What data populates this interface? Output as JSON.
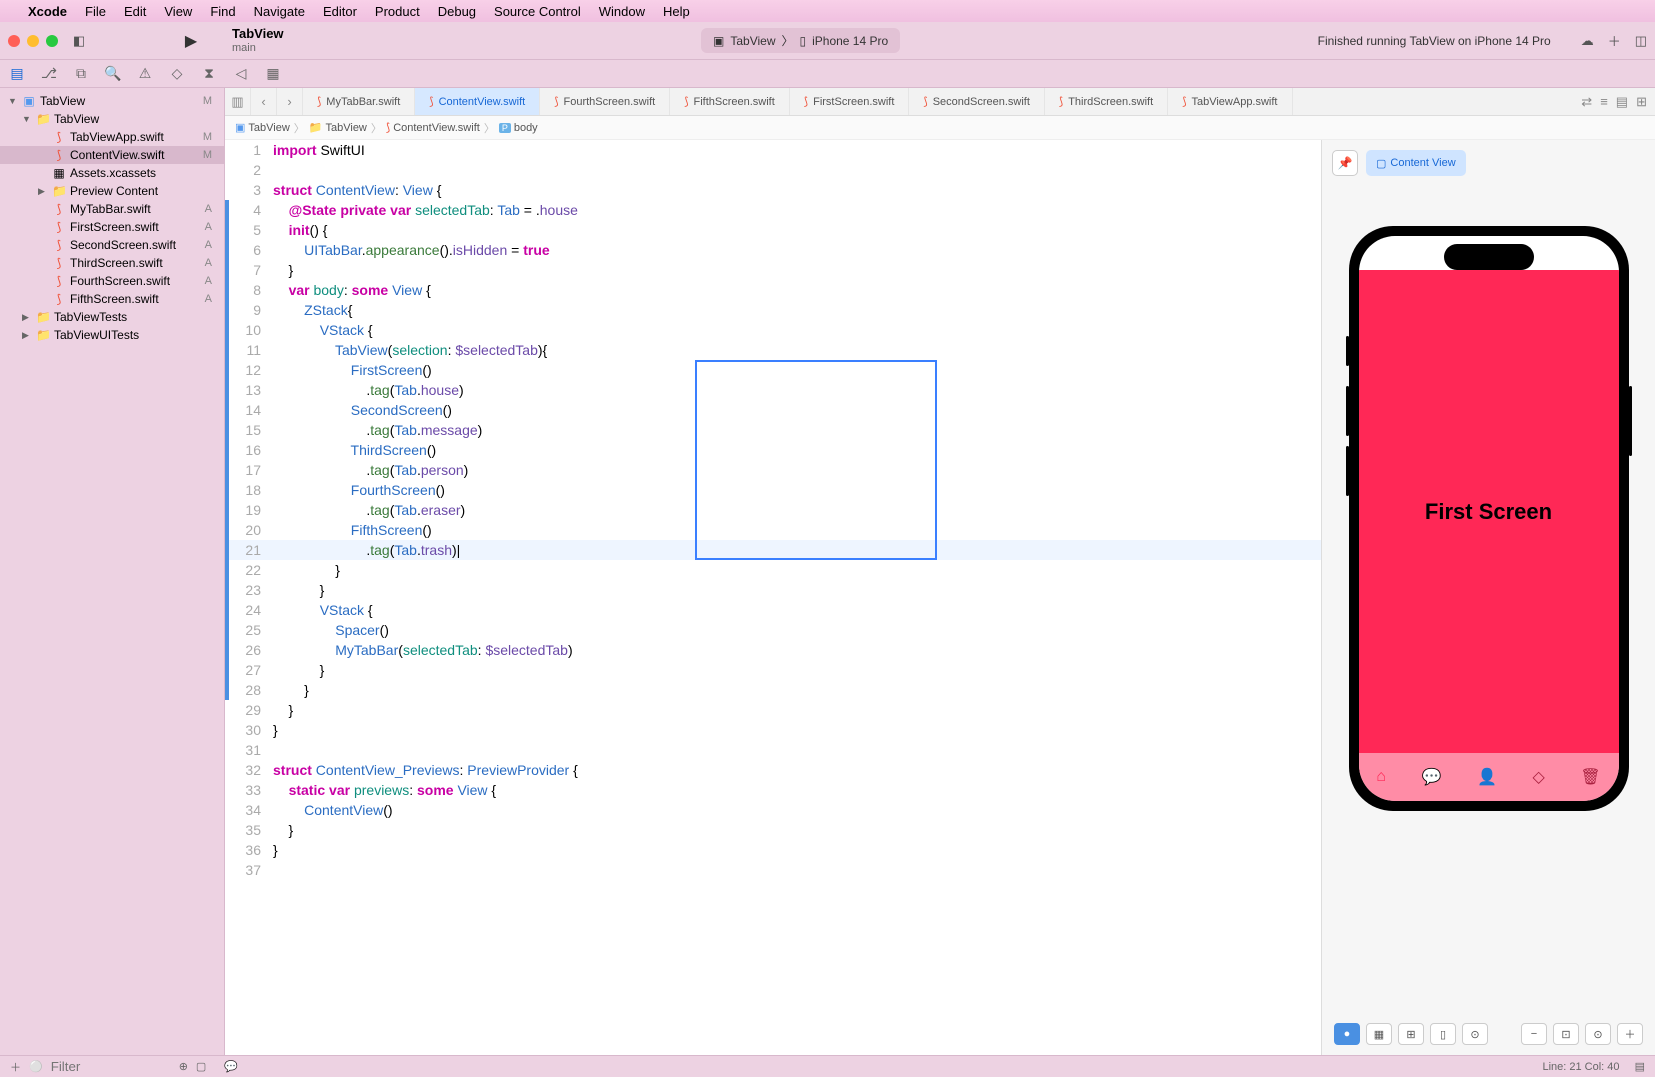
{
  "menubar": {
    "app": "Xcode",
    "items": [
      "File",
      "Edit",
      "View",
      "Find",
      "Navigate",
      "Editor",
      "Product",
      "Debug",
      "Source Control",
      "Window",
      "Help"
    ]
  },
  "toolbar": {
    "scheme_title": "TabView",
    "scheme_branch": "main",
    "run_target_scheme": "TabView",
    "run_target_device": "iPhone 14 Pro",
    "status": "Finished running TabView on iPhone 14 Pro"
  },
  "tabs": [
    {
      "name": "MyTabBar.swift",
      "active": false
    },
    {
      "name": "ContentView.swift",
      "active": true
    },
    {
      "name": "FourthScreen.swift",
      "active": false
    },
    {
      "name": "FifthScreen.swift",
      "active": false
    },
    {
      "name": "FirstScreen.swift",
      "active": false
    },
    {
      "name": "SecondScreen.swift",
      "active": false
    },
    {
      "name": "ThirdScreen.swift",
      "active": false
    },
    {
      "name": "TabViewApp.swift",
      "active": false
    }
  ],
  "jumpbar": [
    "TabView",
    "TabView",
    "ContentView.swift",
    "body"
  ],
  "sidebar": [
    {
      "indent": 0,
      "icon": "proj",
      "name": "TabView",
      "badge": "M",
      "disclosure": "▼"
    },
    {
      "indent": 1,
      "icon": "folder",
      "name": "TabView",
      "disclosure": "▼"
    },
    {
      "indent": 2,
      "icon": "swift",
      "name": "TabViewApp.swift",
      "badge": "M"
    },
    {
      "indent": 2,
      "icon": "swift",
      "name": "ContentView.swift",
      "badge": "M",
      "selected": true
    },
    {
      "indent": 2,
      "icon": "assets",
      "name": "Assets.xcassets"
    },
    {
      "indent": 2,
      "icon": "folder",
      "name": "Preview Content",
      "disclosure": "▶"
    },
    {
      "indent": 2,
      "icon": "swift",
      "name": "MyTabBar.swift",
      "badge": "A"
    },
    {
      "indent": 2,
      "icon": "swift",
      "name": "FirstScreen.swift",
      "badge": "A"
    },
    {
      "indent": 2,
      "icon": "swift",
      "name": "SecondScreen.swift",
      "badge": "A"
    },
    {
      "indent": 2,
      "icon": "swift",
      "name": "ThirdScreen.swift",
      "badge": "A"
    },
    {
      "indent": 2,
      "icon": "swift",
      "name": "FourthScreen.swift",
      "badge": "A"
    },
    {
      "indent": 2,
      "icon": "swift",
      "name": "FifthScreen.swift",
      "badge": "A"
    },
    {
      "indent": 1,
      "icon": "folder",
      "name": "TabViewTests",
      "disclosure": "▶"
    },
    {
      "indent": 1,
      "icon": "folder",
      "name": "TabViewUITests",
      "disclosure": "▶"
    }
  ],
  "filter_placeholder": "Filter",
  "preview": {
    "chip": "Content View",
    "screen_title": "First Screen"
  },
  "cursor": {
    "line": 21,
    "col": 40
  },
  "code_lines": [
    {
      "n": 1,
      "html": "<span class='kw'>import</span> SwiftUI"
    },
    {
      "n": 2,
      "html": ""
    },
    {
      "n": 3,
      "html": "<span class='kw'>struct</span> <span class='type'>ContentView</span>: <span class='type'>View</span> {"
    },
    {
      "n": 4,
      "html": "    <span class='kw'>@State</span> <span class='kw'>private</span> <span class='kw'>var</span> <span class='ident'>selectedTab</span>: <span class='type'>Tab</span> = .<span class='enum'>house</span>",
      "bar": true
    },
    {
      "n": 5,
      "html": "    <span class='kw'>init</span>() {",
      "bar": true
    },
    {
      "n": 6,
      "html": "        <span class='type'>UITabBar</span>.<span class='func'>appearance</span>().<span class='prop'>isHidden</span> = <span class='kw'>true</span>",
      "bar": true
    },
    {
      "n": 7,
      "html": "    }",
      "bar": true
    },
    {
      "n": 8,
      "html": "    <span class='kw'>var</span> <span class='ident'>body</span>: <span class='kw'>some</span> <span class='type'>View</span> {",
      "bar": true
    },
    {
      "n": 9,
      "html": "        <span class='type'>ZStack</span>{",
      "bar": true
    },
    {
      "n": 10,
      "html": "            <span class='type'>VStack</span> {",
      "bar": true
    },
    {
      "n": 11,
      "html": "                <span class='type'>TabView</span>(<span class='ident'>selection</span>: <span class='prop'>$selectedTab</span>){",
      "bar": true
    },
    {
      "n": 12,
      "html": "                    <span class='type'>FirstScreen</span>()",
      "bar": true
    },
    {
      "n": 13,
      "html": "                        .<span class='func'>tag</span>(<span class='type'>Tab</span>.<span class='enum'>house</span>)",
      "bar": true
    },
    {
      "n": 14,
      "html": "                    <span class='type'>SecondScreen</span>()",
      "bar": true
    },
    {
      "n": 15,
      "html": "                        .<span class='func'>tag</span>(<span class='type'>Tab</span>.<span class='enum'>message</span>)",
      "bar": true
    },
    {
      "n": 16,
      "html": "                    <span class='type'>ThirdScreen</span>()",
      "bar": true
    },
    {
      "n": 17,
      "html": "                        .<span class='func'>tag</span>(<span class='type'>Tab</span>.<span class='enum'>person</span>)",
      "bar": true
    },
    {
      "n": 18,
      "html": "                    <span class='type'>FourthScreen</span>()",
      "bar": true
    },
    {
      "n": 19,
      "html": "                        .<span class='func'>tag</span>(<span class='type'>Tab</span>.<span class='enum'>eraser</span>)",
      "bar": true
    },
    {
      "n": 20,
      "html": "                    <span class='type'>FifthScreen</span>()",
      "bar": true
    },
    {
      "n": 21,
      "html": "                        .<span class='func'>tag</span>(<span class='type'>Tab</span>.<span class='enum'>trash</span>)|",
      "bar": true,
      "cursor": true
    },
    {
      "n": 22,
      "html": "                }",
      "bar": true
    },
    {
      "n": 23,
      "html": "            }",
      "bar": true
    },
    {
      "n": 24,
      "html": "            <span class='type'>VStack</span> {",
      "bar": true
    },
    {
      "n": 25,
      "html": "                <span class='type'>Spacer</span>()",
      "bar": true
    },
    {
      "n": 26,
      "html": "                <span class='type'>MyTabBar</span>(<span class='ident'>selectedTab</span>: <span class='prop'>$selectedTab</span>)",
      "bar": true
    },
    {
      "n": 27,
      "html": "            }",
      "bar": true
    },
    {
      "n": 28,
      "html": "        }",
      "bar": true
    },
    {
      "n": 29,
      "html": "    }"
    },
    {
      "n": 30,
      "html": "}"
    },
    {
      "n": 31,
      "html": ""
    },
    {
      "n": 32,
      "html": "<span class='kw'>struct</span> <span class='type'>ContentView_Previews</span>: <span class='type'>PreviewProvider</span> {"
    },
    {
      "n": 33,
      "html": "    <span class='kw'>static</span> <span class='kw'>var</span> <span class='ident'>previews</span>: <span class='kw'>some</span> <span class='type'>View</span> {"
    },
    {
      "n": 34,
      "html": "        <span class='type'>ContentView</span>()"
    },
    {
      "n": 35,
      "html": "    }"
    },
    {
      "n": 36,
      "html": "}"
    },
    {
      "n": 37,
      "html": ""
    }
  ],
  "statusbar": {
    "line_col": "Line: 21  Col: 40"
  }
}
